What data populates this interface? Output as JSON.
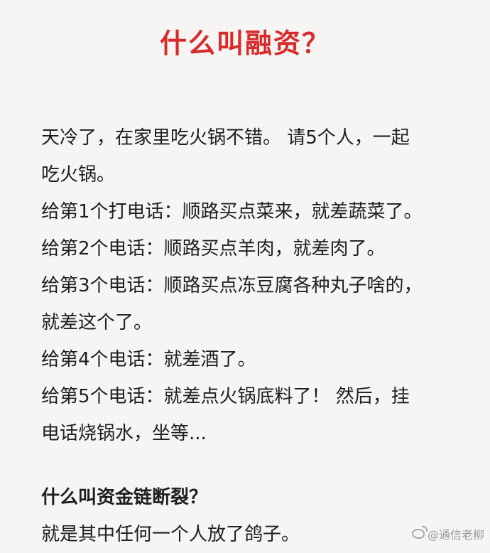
{
  "title": "什么叫融资？",
  "paragraph_lines": [
    "天冷了，在家里吃火锅不错。 请5个人，一起",
    "吃火锅。",
    "给第1个打电话：顺路买点菜来，就差蔬菜了。",
    "给第2个电话：顺路买点羊肉，就差肉了。",
    "给第3个电话：顺路买点冻豆腐各种丸子啥的，",
    "就差这个了。",
    "给第4个电话：就差酒了。",
    "给第5个电话：就差点火锅底料了！ 然后，挂",
    "电话烧锅水，坐等..."
  ],
  "question": "什么叫资金链断裂？",
  "answer": "就是其中任何一个人放了鸽子。",
  "watermark": {
    "icon": "weibo-icon",
    "text": "@通信老柳"
  }
}
